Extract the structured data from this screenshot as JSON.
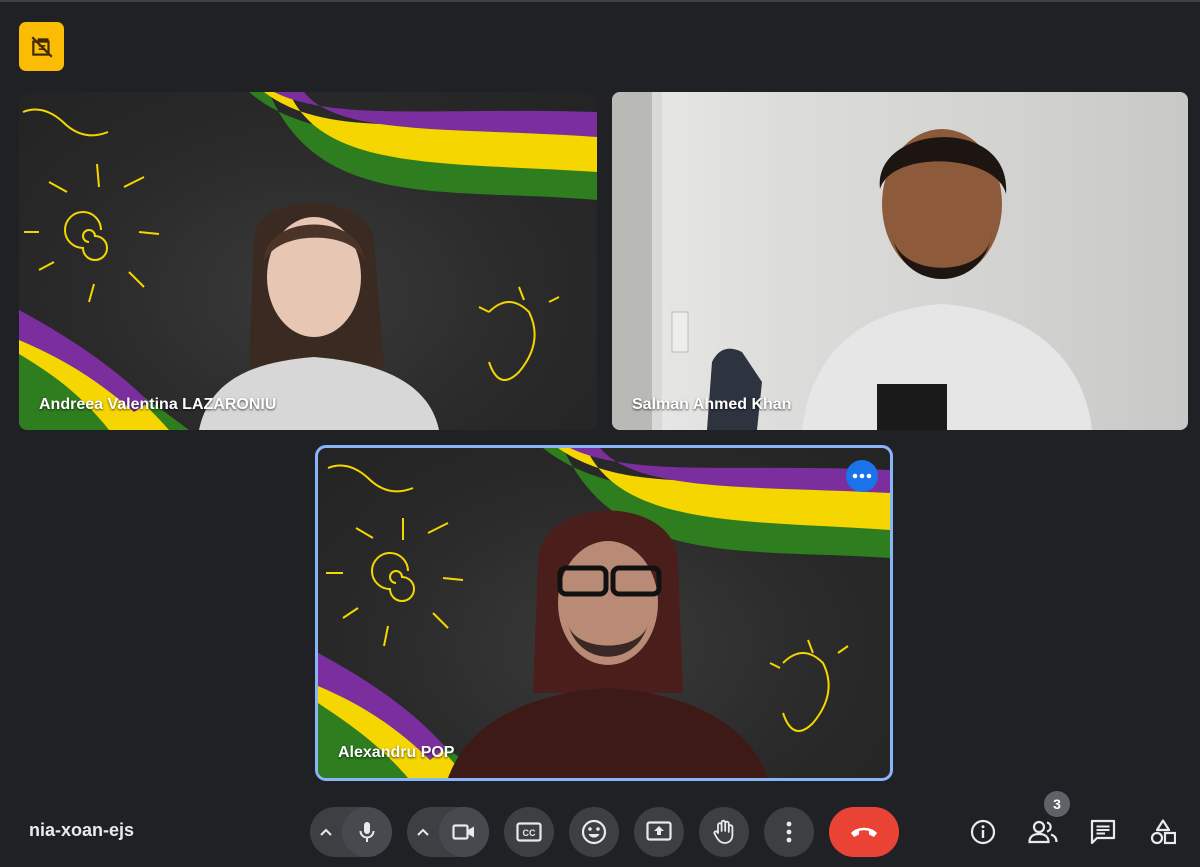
{
  "meeting": {
    "code": "nia-xoan-ejs"
  },
  "participants": [
    {
      "name": "Andreea Valentina LAZARONIU",
      "background": "board"
    },
    {
      "name": "Salman Ahmed Khan",
      "background": "room"
    },
    {
      "name": "Alexandru POP",
      "background": "board",
      "active_speaker": true
    }
  ],
  "controls": {
    "people_count": "3",
    "icons": [
      "microphone-icon",
      "camera-icon",
      "captions-icon",
      "emoji-icon",
      "present-icon",
      "raise-hand-icon",
      "more-options-icon",
      "end-call-icon",
      "info-icon",
      "people-icon",
      "chat-icon",
      "activities-icon"
    ]
  },
  "colors": {
    "background": "#202124",
    "control": "#3c4043",
    "end_call": "#ea4335",
    "recording_badge": "#fbbc04",
    "active_outline": "#8ab4f8",
    "purple_stripe": "#7b2f9e",
    "yellow_stripe": "#f5d600",
    "green_stripe": "#2e7d1e"
  }
}
